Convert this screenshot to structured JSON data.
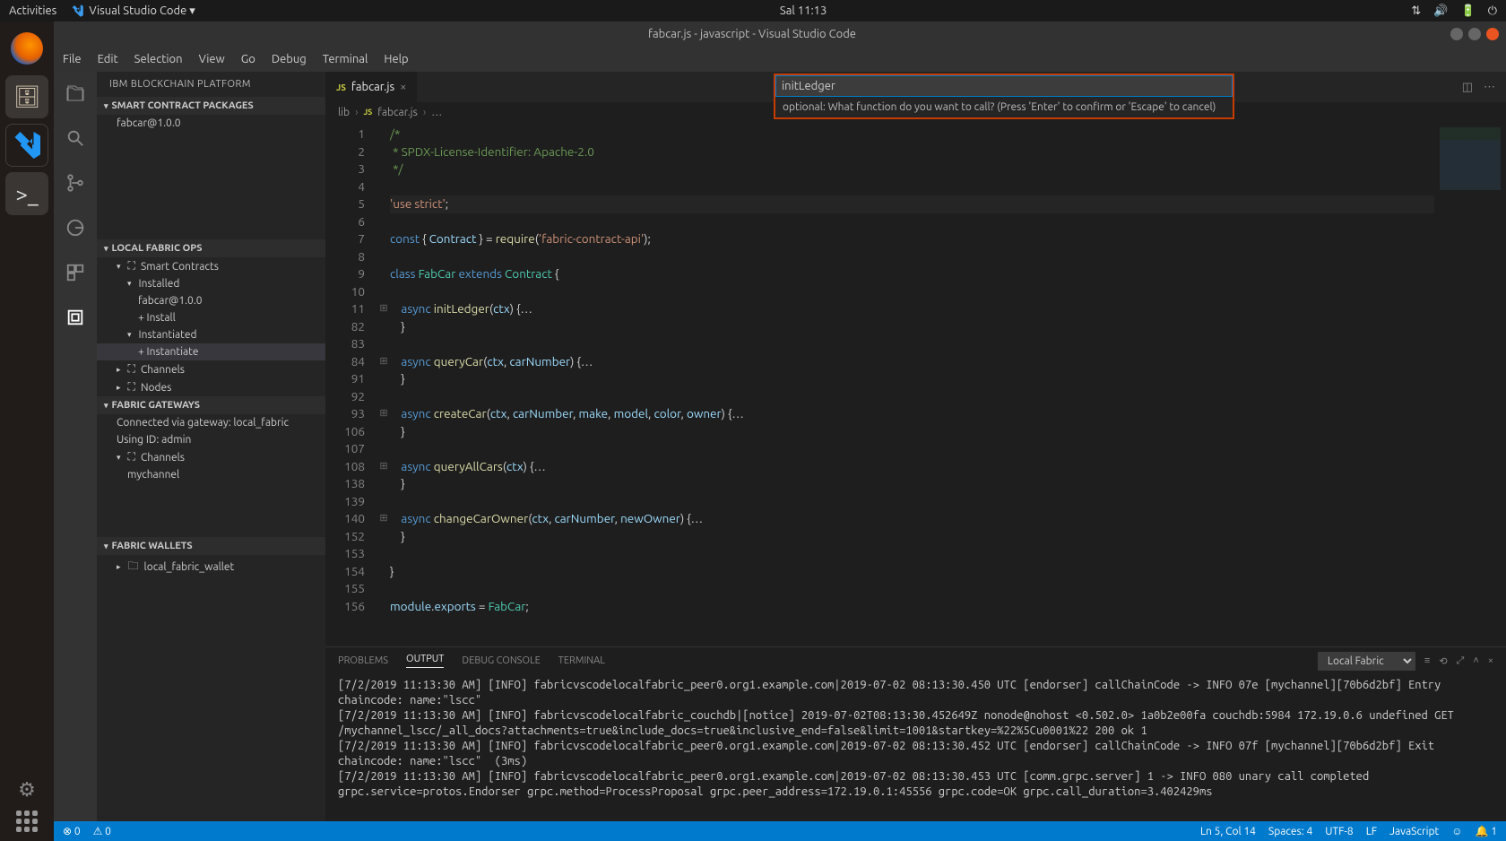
{
  "topbar": {
    "activities": "Activities",
    "app": "Visual Studio Code ▾",
    "clock": "Sal 11:13"
  },
  "window": {
    "title": "fabcar.js - javascript - Visual Studio Code"
  },
  "menubar": [
    "File",
    "Edit",
    "Selection",
    "View",
    "Go",
    "Debug",
    "Terminal",
    "Help"
  ],
  "sidebar": {
    "title": "IBM BLOCKCHAIN PLATFORM",
    "panels": {
      "packages": {
        "header": "SMART CONTRACT PACKAGES",
        "items": [
          "fabcar@1.0.0"
        ]
      },
      "localops": {
        "header": "LOCAL FABRIC OPS",
        "sc_label": "Smart Contracts",
        "installed": "Installed",
        "installed_item": "fabcar@1.0.0",
        "install_action": "+ Install",
        "instantiated": "Instantiated",
        "instantiate_action": "+ Instantiate",
        "channels": "Channels",
        "nodes": "Nodes"
      },
      "gateways": {
        "header": "FABRIC GATEWAYS",
        "connected": "Connected via gateway: local_fabric",
        "using_id": "Using ID: admin",
        "channels_label": "Channels",
        "channel_item": "mychannel"
      },
      "wallets": {
        "header": "FABRIC WALLETS",
        "item": "local_fabric_wallet"
      }
    }
  },
  "tabs": {
    "file": "fabcar.js"
  },
  "breadcrumb": {
    "p0": "lib",
    "p1": "fabcar.js"
  },
  "overlay": {
    "value": "initLedger",
    "hint": "optional: What function do you want to call? (Press 'Enter' to confirm or 'Escape' to cancel)"
  },
  "code": {
    "line_numbers": [
      "1",
      "2",
      "3",
      "4",
      "5",
      "6",
      "7",
      "8",
      "9",
      "10",
      "11",
      "82",
      "83",
      "84",
      "91",
      "92",
      "93",
      "106",
      "107",
      "108",
      "138",
      "139",
      "140",
      "152",
      "153",
      "154",
      "155",
      "156"
    ],
    "fold": {
      "11": "⊞",
      "84": "⊞",
      "93": "⊞",
      "108": "⊞",
      "140": "⊞"
    }
  },
  "panel": {
    "tabs": {
      "problems": "PROBLEMS",
      "output": "OUTPUT",
      "debug": "DEBUG CONSOLE",
      "terminal": "TERMINAL"
    },
    "select": "Local Fabric",
    "output": "[7/2/2019 11:13:30 AM] [INFO] fabricvscodelocalfabric_peer0.org1.example.com|2019-07-02 08:13:30.450 UTC [endorser] callChainCode -> INFO 07e [mychannel][70b6d2bf] Entry chaincode: name:\"lscc\"\n[7/2/2019 11:13:30 AM] [INFO] fabricvscodelocalfabric_couchdb|[notice] 2019-07-02T08:13:30.452649Z nonode@nohost <0.502.0> 1a0b2e00fa couchdb:5984 172.19.0.6 undefined GET /mychannel_lscc/_all_docs?attachments=true&include_docs=true&inclusive_end=false&limit=1001&startkey=%22%5Cu0001%22 200 ok 1\n[7/2/2019 11:13:30 AM] [INFO] fabricvscodelocalfabric_peer0.org1.example.com|2019-07-02 08:13:30.452 UTC [endorser] callChainCode -> INFO 07f [mychannel][70b6d2bf] Exit chaincode: name:\"lscc\"  (3ms)\n[7/2/2019 11:13:30 AM] [INFO] fabricvscodelocalfabric_peer0.org1.example.com|2019-07-02 08:13:30.453 UTC [comm.grpc.server] 1 -> INFO 080 unary call completed grpc.service=protos.Endorser grpc.method=ProcessProposal grpc.peer_address=172.19.0.1:45556 grpc.code=OK grpc.call_duration=3.402429ms"
  },
  "status": {
    "errors": "0",
    "warnings": "0",
    "line_col": "Ln 5, Col 14",
    "spaces": "Spaces: 4",
    "encoding": "UTF-8",
    "eol": "LF",
    "lang": "JavaScript",
    "bell_count": "1"
  }
}
